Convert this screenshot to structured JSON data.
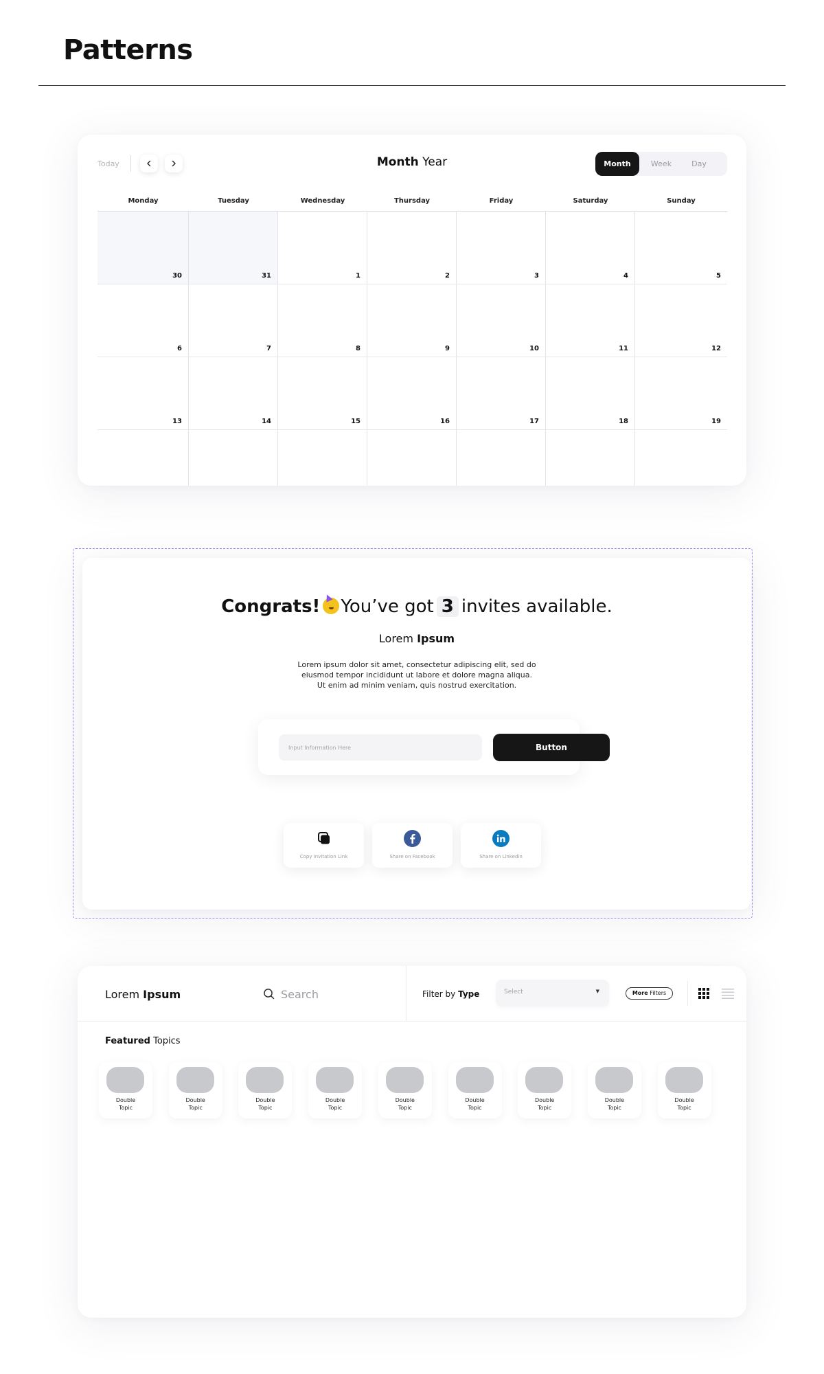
{
  "page": {
    "title": "Patterns"
  },
  "calendar": {
    "today_label": "Today",
    "title_bold": "Month",
    "title_rest": "Year",
    "views": {
      "month": "Month",
      "week": "Week",
      "day": "Day"
    },
    "active_view": "Month",
    "weekdays": [
      "Monday",
      "Tuesday",
      "Wednesday",
      "Thursday",
      "Friday",
      "Saturday",
      "Sunday"
    ],
    "weeks": [
      [
        "30",
        "31",
        "1",
        "2",
        "3",
        "4",
        "5"
      ],
      [
        "6",
        "7",
        "8",
        "9",
        "10",
        "11",
        "12"
      ],
      [
        "13",
        "14",
        "15",
        "16",
        "17",
        "18",
        "19"
      ],
      [
        "",
        "",
        "",
        "",
        "",
        "",
        ""
      ]
    ],
    "muted_days": [
      "30",
      "31"
    ]
  },
  "invite": {
    "congrats": "Congrats!",
    "you_got": "You’ve got",
    "count": "3",
    "available": "invites available.",
    "lorem_light": "Lorem",
    "lorem_bold": "Ipsum",
    "body": "Lorem ipsum dolor sit amet, consectetur adipiscing elit, sed do eiusmod tempor incididunt ut labore et dolore magna aliqua. Ut enim ad minim veniam, quis nostrud exercitation.",
    "input_placeholder": "Input Information Here",
    "button_label": "Button",
    "share": {
      "copy": "Copy Invitation Link",
      "facebook": "Share on Facebook",
      "linkedin": "Share on Linkedin"
    },
    "colors": {
      "facebook": "#3b5998",
      "linkedin": "#0a7bbf"
    }
  },
  "topics_panel": {
    "brand_light": "Lorem",
    "brand_bold": "Ipsum",
    "search_placeholder": "Search",
    "filter_light": "Filter by",
    "filter_bold": "Type",
    "select_placeholder": "Select",
    "more_bold": "More",
    "more_rest": "Filters",
    "featured_bold": "Featured",
    "featured_rest": "Topics",
    "topics": [
      "Double Topic",
      "Double Topic",
      "Double Topic",
      "Double Topic",
      "Double Topic",
      "Double Topic",
      "Double Topic",
      "Double Topic",
      "Double Topic"
    ]
  }
}
